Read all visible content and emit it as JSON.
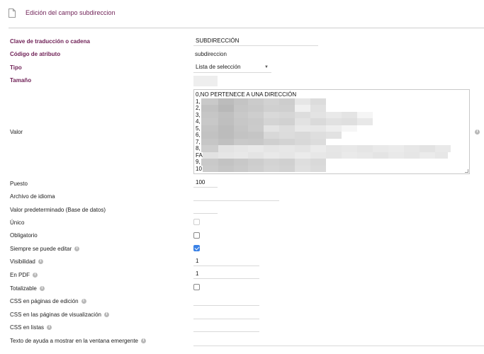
{
  "header": {
    "title": "Edición del campo subdireccion",
    "icon": "document-icon"
  },
  "fields": {
    "clave": {
      "label": "Clave de traducción o cadena",
      "value": "SUBDIRECCIÓN"
    },
    "codigo": {
      "label": "Código de atributo",
      "value": "subdireccion"
    },
    "tipo": {
      "label": "Tipo",
      "value": "Lista de selección"
    },
    "tamano": {
      "label": "Tamaño",
      "value": ""
    },
    "valor": {
      "label": "Valor",
      "lines": [
        "0,NO PERTENECE A UNA DIRECCIÓN",
        "1,",
        "2,",
        "3,",
        "4,",
        "5,",
        "6,",
        "7,",
        "8,",
        "FA",
        "9,",
        "10"
      ]
    },
    "puesto": {
      "label": "Puesto",
      "value": "100"
    },
    "archivo_idioma": {
      "label": "Archivo de idioma",
      "value": ""
    },
    "valor_predeterminado": {
      "label": "Valor predeterminado (Base de datos)",
      "value": ""
    },
    "unico": {
      "label": "Único",
      "checked": false,
      "disabled": true
    },
    "obligatorio": {
      "label": "Obligatorio",
      "checked": false
    },
    "siempre_editar": {
      "label": "Siempre se puede editar",
      "checked": true
    },
    "visibilidad": {
      "label": "Visibilidad",
      "value": "1"
    },
    "en_pdf": {
      "label": "En PDF",
      "value": "1"
    },
    "totalizable": {
      "label": "Totalizable",
      "checked": false
    },
    "css_edicion": {
      "label": "CSS en páginas de edición",
      "value": ""
    },
    "css_visualizacion": {
      "label": "CSS en las páginas de visualización",
      "value": ""
    },
    "css_listas": {
      "label": "CSS en listas",
      "value": ""
    },
    "texto_ayuda": {
      "label": "Texto de ayuda a mostrar en la ventana emergente",
      "value": ""
    }
  },
  "colors": {
    "accent": "#6e1f55",
    "checkbox_checked": "#3b82e6"
  }
}
